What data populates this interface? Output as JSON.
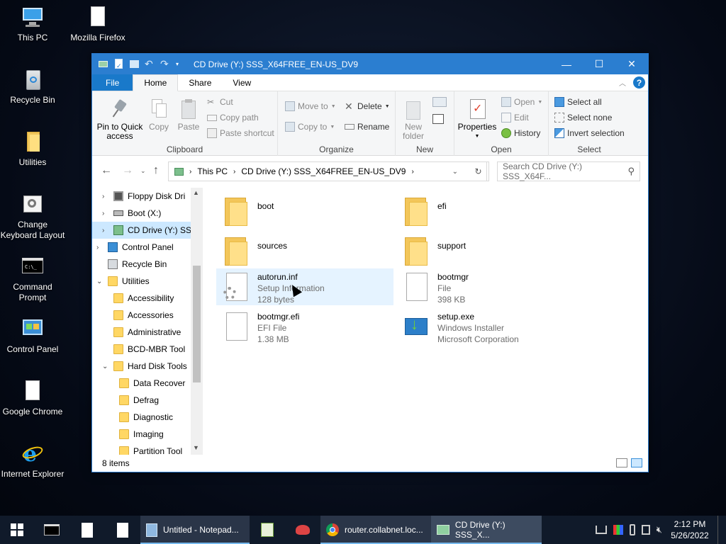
{
  "desktop": {
    "icons": [
      {
        "label": "This PC",
        "icon": "this-pc-icon"
      },
      {
        "label": "Mozilla Firefox",
        "icon": "file-icon"
      },
      {
        "label": "Recycle Bin",
        "icon": "recycle-bin-icon"
      },
      {
        "label": "Utilities",
        "icon": "folder-icon"
      },
      {
        "label": "Change Keyboard Layout",
        "icon": "keyboard-settings-icon"
      },
      {
        "label": "Command Prompt",
        "icon": "cmd-icon"
      },
      {
        "label": "Control Panel",
        "icon": "control-panel-icon"
      },
      {
        "label": "Google Chrome",
        "icon": "file-icon"
      },
      {
        "label": "Internet Explorer",
        "icon": "internet-explorer-icon"
      }
    ]
  },
  "window": {
    "title": "CD Drive (Y:) SSS_X64FREE_EN-US_DV9",
    "controls": {
      "minimize": "—",
      "maximize": "☐",
      "close": "✕"
    },
    "tabs": {
      "file": "File",
      "home": "Home",
      "share": "Share",
      "view": "View"
    },
    "help": "?",
    "ribbon": {
      "clipboard": {
        "label": "Clipboard",
        "pin": "Pin to Quick access",
        "copy": "Copy",
        "paste": "Paste",
        "cut": "Cut",
        "copy_path": "Copy path",
        "paste_shortcut": "Paste shortcut"
      },
      "organize": {
        "label": "Organize",
        "move_to": "Move to",
        "copy_to": "Copy to",
        "delete": "Delete",
        "rename": "Rename"
      },
      "new": {
        "label": "New",
        "new_folder": "New folder"
      },
      "open": {
        "label": "Open",
        "properties": "Properties",
        "open": "Open",
        "edit": "Edit",
        "history": "History"
      },
      "select": {
        "label": "Select",
        "select_all": "Select all",
        "select_none": "Select none",
        "invert": "Invert selection"
      }
    },
    "address": {
      "crumbs": [
        "This PC",
        "CD Drive (Y:) SSS_X64FREE_EN-US_DV9"
      ],
      "search_placeholder": "Search CD Drive (Y:) SSS_X64F..."
    },
    "nav": [
      {
        "label": "Floppy Disk Dri",
        "indent": 1,
        "icon": "floppy-icon",
        "chev": "›"
      },
      {
        "label": "Boot (X:)",
        "indent": 1,
        "icon": "drive-icon",
        "chev": "›"
      },
      {
        "label": "CD Drive (Y:) SS",
        "indent": 1,
        "icon": "cd-drive-icon",
        "chev": "›",
        "selected": true
      },
      {
        "label": "Control Panel",
        "indent": 0,
        "icon": "control-panel-icon",
        "chev": "›"
      },
      {
        "label": "Recycle Bin",
        "indent": 0,
        "icon": "recycle-bin-icon",
        "chev": ""
      },
      {
        "label": "Utilities",
        "indent": 0,
        "icon": "folder-icon",
        "chev": "⌄"
      },
      {
        "label": "Accessibility",
        "indent": 1,
        "icon": "folder-icon",
        "chev": ""
      },
      {
        "label": "Accessories",
        "indent": 1,
        "icon": "folder-icon",
        "chev": ""
      },
      {
        "label": "Administrative",
        "indent": 1,
        "icon": "folder-icon",
        "chev": ""
      },
      {
        "label": "BCD-MBR Tool",
        "indent": 1,
        "icon": "folder-icon",
        "chev": ""
      },
      {
        "label": "Hard Disk Tools",
        "indent": 1,
        "icon": "folder-icon",
        "chev": "⌄"
      },
      {
        "label": "Data Recover",
        "indent": 2,
        "icon": "folder-icon",
        "chev": ""
      },
      {
        "label": "Defrag",
        "indent": 2,
        "icon": "folder-icon",
        "chev": ""
      },
      {
        "label": "Diagnostic",
        "indent": 2,
        "icon": "folder-icon",
        "chev": ""
      },
      {
        "label": "Imaging",
        "indent": 2,
        "icon": "folder-icon",
        "chev": ""
      },
      {
        "label": "Partition Tool",
        "indent": 2,
        "icon": "folder-icon",
        "chev": ""
      }
    ],
    "files": [
      {
        "name": "boot",
        "line2": "",
        "line3": "",
        "icon": "folder-icon"
      },
      {
        "name": "efi",
        "line2": "",
        "line3": "",
        "icon": "folder-icon"
      },
      {
        "name": "sources",
        "line2": "",
        "line3": "",
        "icon": "folder-icon"
      },
      {
        "name": "support",
        "line2": "",
        "line3": "",
        "icon": "folder-icon"
      },
      {
        "name": "autorun.inf",
        "line2": "Setup Information",
        "line3": "128 bytes",
        "icon": "setup-info-file-icon"
      },
      {
        "name": "bootmgr",
        "line2": "File",
        "line3": "398 KB",
        "icon": "file-icon"
      },
      {
        "name": "bootmgr.efi",
        "line2": "EFI File",
        "line3": "1.38 MB",
        "icon": "file-icon"
      },
      {
        "name": "setup.exe",
        "line2": "Windows Installer",
        "line3": "Microsoft Corporation",
        "icon": "installer-icon"
      }
    ],
    "status": "8 items"
  },
  "taskbar": {
    "tasks": [
      {
        "label": "Untitled - Notepad...",
        "icon": "notepad-icon"
      },
      {
        "label": "router.collabnet.loc...",
        "icon": "chrome-icon"
      },
      {
        "label": "CD Drive (Y:) SSS_X...",
        "icon": "explorer-icon"
      }
    ],
    "clock": {
      "time": "2:12 PM",
      "date": "5/26/2022"
    }
  }
}
